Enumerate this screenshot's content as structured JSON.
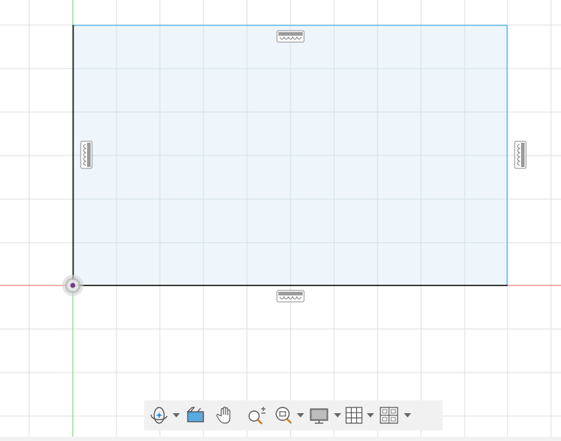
{
  "canvas": {
    "background": "#ffffff",
    "grid_color": "#dcdcdc",
    "x_axis_color": "#e05a5a",
    "y_axis_color": "#5ad65a",
    "sketch_fill": "#eef6fc",
    "sketch_edge_color": "#5bb6e6",
    "sketch_line_color": "#1a1a1a"
  },
  "sketch": {
    "shape": "rectangle",
    "constraints": [
      {
        "name": "horizontal-constraint-top",
        "icon": "horizontal-constraint-icon"
      },
      {
        "name": "vertical-constraint-left",
        "icon": "vertical-constraint-icon"
      },
      {
        "name": "vertical-constraint-right",
        "icon": "vertical-constraint-icon"
      },
      {
        "name": "horizontal-constraint-bottom",
        "icon": "horizontal-constraint-icon"
      }
    ],
    "origin_marker": "origin-point-icon"
  },
  "toolbar": {
    "tools": [
      {
        "name": "orbit",
        "icon": "orbit-icon",
        "has_dropdown": true
      },
      {
        "name": "look-at",
        "icon": "look-at-icon",
        "has_dropdown": false
      },
      {
        "name": "pan",
        "icon": "pan-hand-icon",
        "has_dropdown": false
      },
      {
        "name": "zoom",
        "icon": "zoom-icon",
        "has_dropdown": false
      },
      {
        "name": "fit",
        "icon": "zoom-window-icon",
        "has_dropdown": true
      },
      {
        "name": "display-settings",
        "icon": "display-monitor-icon",
        "has_dropdown": true
      },
      {
        "name": "grid-snaps",
        "icon": "grid-icon",
        "has_dropdown": true
      },
      {
        "name": "viewports",
        "icon": "viewports-icon",
        "has_dropdown": true
      }
    ]
  }
}
